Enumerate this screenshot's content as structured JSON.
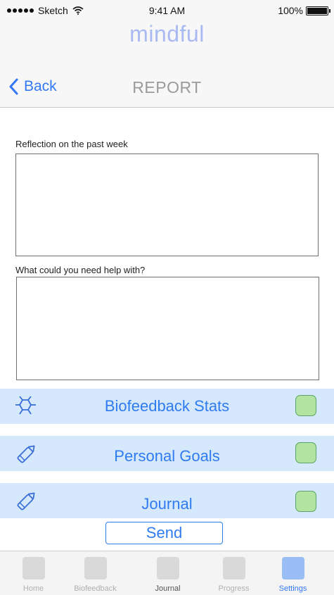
{
  "status_bar": {
    "carrier": "Sketch",
    "time": "9:41 AM",
    "battery": "100%"
  },
  "header": {
    "brand": "mindful",
    "back_label": "Back",
    "title": "REPORT"
  },
  "form": {
    "reflection_label": "Reflection on the past week",
    "reflection_value": "",
    "help_label": "What could you need help with?",
    "help_value": ""
  },
  "rows": [
    {
      "label": "Biofeedback Stats",
      "icon": "molecule-icon"
    },
    {
      "label": "Personal Goals",
      "icon": "pencil-icon"
    },
    {
      "label": "Journal",
      "icon": "pencil-icon"
    }
  ],
  "send_label": "Send",
  "tabs": [
    {
      "label": "Home"
    },
    {
      "label": "Biofeedback"
    },
    {
      "label": "Journal"
    },
    {
      "label": "Progress"
    },
    {
      "label": "Settings"
    }
  ],
  "colors": {
    "accent": "#3578f5",
    "brand": "#a9b9f2",
    "row_bg": "#d6e8fb",
    "checkbox": "#b3e3a0"
  }
}
